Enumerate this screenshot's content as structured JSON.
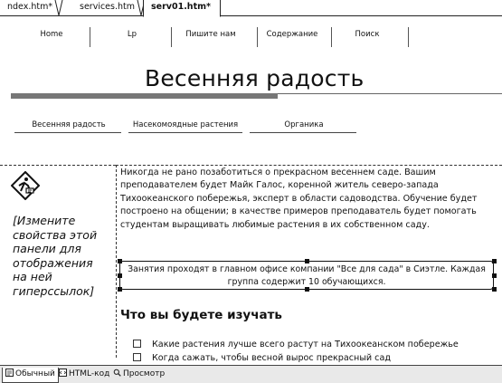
{
  "doc_tabs": [
    {
      "label": "ndex.htm*"
    },
    {
      "label": "services.htm"
    },
    {
      "label": "serv01.htm*"
    }
  ],
  "nav": {
    "links": [
      "Home",
      "Lp",
      "Пишите нам",
      "Содержание",
      "Поиск"
    ]
  },
  "banner": {
    "title": "Весенняя радость"
  },
  "subnav": {
    "links": [
      "Весенняя радость",
      "Насекомоядные растения",
      "Органика"
    ]
  },
  "left_panel": {
    "placeholder": "[Измените свойства этой панели для отображения на ней гиперссылок]"
  },
  "main": {
    "paragraph": "Никогда не рано позаботиться о прекрасном весеннем саде. Вашим преподавателем будет Майк Галос, коренной житель северо-запада Тихоокеанского побережья, эксперт в области садоводства. Обучение будет построено на общении; в качестве примеров преподаватель будет помогать студентам выращивать любимые растения в их собственном саду.",
    "callout": "Занятия проходят в главном офисе компании \"Все для сада\" в Сиэтле. Каждая группа содержит 10 обучающихся.",
    "section_heading": "Что вы будете изучать",
    "checklist": [
      "Какие растения лучше всего растут на Тихоокеанском побережье",
      "Когда сажать, чтобы весной вырос прекрасный сад"
    ]
  },
  "view_tabs": [
    {
      "label": "Обычный",
      "icon": "normal-view-icon"
    },
    {
      "label": "HTML-код",
      "icon": "html-view-icon"
    },
    {
      "label": "Просмотр",
      "icon": "preview-icon"
    }
  ]
}
